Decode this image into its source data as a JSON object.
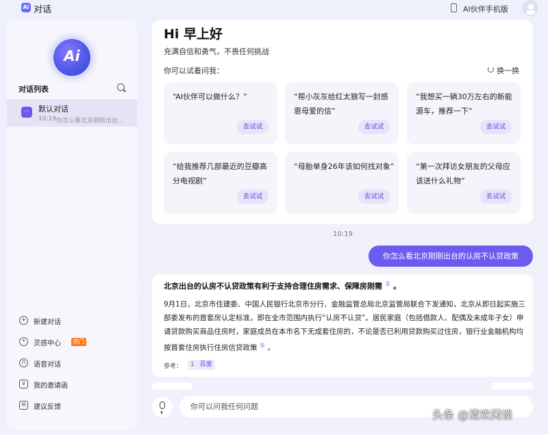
{
  "app": {
    "logo_text": "Ai",
    "title": "对话",
    "mobile_link": "AI伙伴手机版"
  },
  "sidebar": {
    "logo_text": "Ai",
    "conv_list_title": "对话列表",
    "conversations": [
      {
        "title": "默认对话",
        "time": "10:19",
        "preview": "你怎么看北京刚刚出台..."
      }
    ],
    "nav": {
      "new_chat": "新建对话",
      "inspiration": "灵感中心",
      "hot_badge": "热门",
      "voice": "语音对话",
      "invite": "我的邀请函",
      "feedback": "建议反馈"
    }
  },
  "welcome": {
    "greeting": "Hi 早上好",
    "subgreeting": "充满自信和勇气，不畏任何挑战",
    "try_label": "你可以试着问我：",
    "refresh_label": "换一换",
    "try_button": "去试试",
    "prompts": [
      "“AI伙伴可以做什么？”",
      "“帮小灰灰给红太狼写一封感恩母爱的信”",
      "“我想买一辆30万左右的新能源车，推荐一下”",
      "“给我推荐几部最近的豆瓣高分电视剧”",
      "“母胎单身26年该如何找对象”",
      "“第一次拜访女朋友的父母应该送什么礼物”"
    ]
  },
  "chat": {
    "timestamp": "10:19",
    "user_message": "你怎么看北京刚刚出台的认房不认贷政策",
    "answer_title": "北京出台的认房不认贷政策有利于支持合理住房需求、保障房刚需",
    "answer_title_end": "。",
    "answer_body": "9月1日，北京市住建委、中国人民银行北京市分行、金融监管总局北京监管局联合下发通知，北京从即日起实施三部委发布的首套房认定标准，即在全市范围内执行“认房不认贷”。居民家庭（包括借款人、配偶及未成年子女）申请贷款购买商品住房时，家庭成员在本市名下无成套住房的，不论是否已利用贷款购买过住房，银行业金融机构均按首套住房执行住房信贷政策",
    "answer_body_end": "。",
    "cite_number": "1",
    "ref_label": "参考：",
    "ref_number": "1",
    "ref_source": "百度"
  },
  "input": {
    "placeholder": "你可以问我任何问题"
  },
  "watermark": "头条 @清欢闲谈",
  "colors": {
    "accent": "#6b5cf0",
    "hot": "#ff7a1a"
  }
}
